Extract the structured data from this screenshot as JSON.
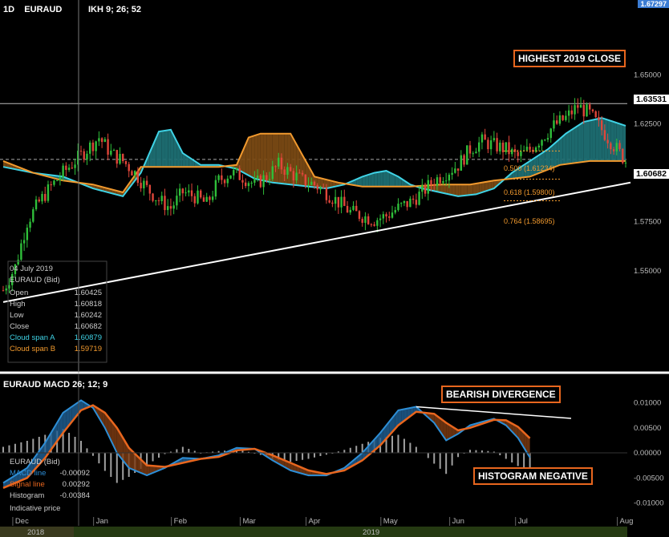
{
  "colors": {
    "bg": "#000000",
    "cloud_a": "#3fd3e6",
    "cloud_b": "#f29a2e",
    "cloud_fill_bull": "#1e6f73",
    "cloud_fill_bear": "#7a4a14",
    "up_candle": "#2fbf3a",
    "down_candle": "#e0463a",
    "macd_line": "#2d8ed6",
    "signal_line": "#e8661e",
    "callout": "#e8661e"
  },
  "header": {
    "timeframe": "1D",
    "symbol": "EURAUD",
    "indicator": "IKH 9; 26; 52"
  },
  "macd_header": {
    "label": "EURAUD  MACD 26; 12; 9"
  },
  "top_price_tag": "1.67297",
  "price_tags": {
    "current": "1.63531",
    "last": "1.60682"
  },
  "callouts": {
    "highest_close": "HIGHEST 2019 CLOSE",
    "bearish_divergence": "BEARISH DIVERGENCE",
    "histogram_negative": "HISTOGRAM NEGATIVE"
  },
  "fib_labels": [
    "0.500 (1.61234)",
    "0.618 (1.59800)",
    "0.764 (1.58695)"
  ],
  "info_box": {
    "date": "04 July 2019",
    "instrument": "EURAUD (Bid)",
    "rows": [
      {
        "label": "Open",
        "value": "1.60425"
      },
      {
        "label": "High",
        "value": "1.60818"
      },
      {
        "label": "Low",
        "value": "1.60242"
      },
      {
        "label": "Close",
        "value": "1.60682"
      },
      {
        "label": "Cloud span A",
        "value": "1.60879"
      },
      {
        "label": "Cloud span B",
        "value": "1.59719"
      }
    ]
  },
  "macd_info": {
    "instrument": "EURAUD (Bid)",
    "rows": [
      {
        "label": "MACD line",
        "value": "-0.00092"
      },
      {
        "label": "Signal line",
        "value": "0.00292"
      },
      {
        "label": "Histogram",
        "value": "-0.00384"
      }
    ],
    "footer": "Indicative price"
  },
  "chart_data": [
    {
      "type": "candlestick",
      "title": "EURAUD IKH 9; 26; 52",
      "ylim": [
        1.5,
        1.68
      ],
      "y_ticks": [
        "1.65000",
        "1.62500",
        "1.60000",
        "1.57500",
        "1.55000"
      ],
      "y_tick_values": [
        1.65,
        1.625,
        1.6,
        1.575,
        1.55
      ],
      "x_labels": [
        "Dec",
        "Jan",
        "Feb",
        "Mar",
        "Apr",
        "May",
        "Jun",
        "Jul",
        "Aug"
      ],
      "year_labels": [
        "2018",
        "2019"
      ],
      "horizontal_lines": [
        1.63531,
        1.60682
      ],
      "close_path": [
        [
          0,
          1.54
        ],
        [
          4,
          1.552
        ],
        [
          8,
          1.575
        ],
        [
          12,
          1.585
        ],
        [
          16,
          1.593
        ],
        [
          20,
          1.6
        ],
        [
          24,
          1.606
        ],
        [
          28,
          1.612
        ],
        [
          32,
          1.618
        ],
        [
          36,
          1.61
        ],
        [
          40,
          1.606
        ],
        [
          44,
          1.6
        ],
        [
          48,
          1.592
        ],
        [
          52,
          1.586
        ],
        [
          56,
          1.582
        ],
        [
          60,
          1.59
        ],
        [
          64,
          1.588
        ],
        [
          68,
          1.584
        ],
        [
          72,
          1.596
        ],
        [
          76,
          1.6
        ],
        [
          80,
          1.598
        ],
        [
          84,
          1.594
        ],
        [
          88,
          1.598
        ],
        [
          92,
          1.604
        ],
        [
          96,
          1.6
        ],
        [
          100,
          1.596
        ],
        [
          104,
          1.594
        ],
        [
          108,
          1.59
        ],
        [
          112,
          1.585
        ],
        [
          116,
          1.58
        ],
        [
          120,
          1.578
        ],
        [
          124,
          1.576
        ],
        [
          128,
          1.578
        ],
        [
          132,
          1.582
        ],
        [
          136,
          1.585
        ],
        [
          140,
          1.59
        ],
        [
          144,
          1.596
        ],
        [
          148,
          1.6
        ],
        [
          152,
          1.604
        ],
        [
          156,
          1.612
        ],
        [
          160,
          1.616
        ],
        [
          164,
          1.614
        ],
        [
          168,
          1.612
        ],
        [
          172,
          1.608
        ],
        [
          176,
          1.612
        ],
        [
          180,
          1.618
        ],
        [
          184,
          1.624
        ],
        [
          188,
          1.628
        ],
        [
          192,
          1.634
        ],
        [
          196,
          1.63
        ],
        [
          200,
          1.622
        ],
        [
          204,
          1.614
        ],
        [
          208,
          1.606
        ]
      ],
      "cloud_span_a": [
        [
          0,
          1.603
        ],
        [
          10,
          1.6
        ],
        [
          20,
          1.598
        ],
        [
          30,
          1.592
        ],
        [
          40,
          1.588
        ],
        [
          46,
          1.6
        ],
        [
          52,
          1.621
        ],
        [
          56,
          1.622
        ],
        [
          60,
          1.61
        ],
        [
          66,
          1.604
        ],
        [
          72,
          1.604
        ],
        [
          78,
          1.602
        ],
        [
          84,
          1.597
        ],
        [
          90,
          1.595
        ],
        [
          96,
          1.594
        ],
        [
          102,
          1.593
        ],
        [
          108,
          1.592
        ],
        [
          114,
          1.594
        ],
        [
          120,
          1.598
        ],
        [
          124,
          1.6
        ],
        [
          128,
          1.601
        ],
        [
          132,
          1.598
        ],
        [
          136,
          1.594
        ],
        [
          140,
          1.592
        ],
        [
          146,
          1.59
        ],
        [
          152,
          1.588
        ],
        [
          158,
          1.589
        ],
        [
          164,
          1.592
        ],
        [
          170,
          1.6
        ],
        [
          176,
          1.606
        ],
        [
          182,
          1.612
        ],
        [
          188,
          1.62
        ],
        [
          194,
          1.626
        ],
        [
          200,
          1.628
        ],
        [
          208,
          1.624
        ]
      ],
      "cloud_span_b": [
        [
          0,
          1.606
        ],
        [
          10,
          1.6
        ],
        [
          20,
          1.596
        ],
        [
          30,
          1.594
        ],
        [
          40,
          1.59
        ],
        [
          46,
          1.603
        ],
        [
          52,
          1.603
        ],
        [
          60,
          1.603
        ],
        [
          66,
          1.603
        ],
        [
          72,
          1.603
        ],
        [
          78,
          1.604
        ],
        [
          82,
          1.618
        ],
        [
          86,
          1.62
        ],
        [
          90,
          1.62
        ],
        [
          96,
          1.62
        ],
        [
          104,
          1.598
        ],
        [
          112,
          1.595
        ],
        [
          120,
          1.593
        ],
        [
          128,
          1.593
        ],
        [
          136,
          1.593
        ],
        [
          146,
          1.594
        ],
        [
          156,
          1.594
        ],
        [
          164,
          1.596
        ],
        [
          176,
          1.598
        ],
        [
          186,
          1.604
        ],
        [
          196,
          1.606
        ],
        [
          208,
          1.606
        ]
      ],
      "trendline": [
        [
          0,
          1.534
        ],
        [
          208,
          1.595
        ]
      ]
    },
    {
      "type": "line",
      "title": "EURAUD MACD 26; 12; 9",
      "ylim": [
        -0.012,
        0.012
      ],
      "y_ticks": [
        "0.01000",
        "0.00500",
        "0.00000",
        "-0.00500",
        "-0.01000"
      ],
      "y_tick_values": [
        0.01,
        0.005,
        0.0,
        -0.005,
        -0.01
      ],
      "series": [
        {
          "name": "MACD line",
          "points": [
            [
              0,
              -0.006
            ],
            [
              8,
              -0.003
            ],
            [
              14,
              0.002
            ],
            [
              20,
              0.008
            ],
            [
              26,
              0.0105
            ],
            [
              30,
              0.009
            ],
            [
              34,
              0.005
            ],
            [
              38,
              0.0
            ],
            [
              42,
              -0.003
            ],
            [
              48,
              -0.0045
            ],
            [
              54,
              -0.003
            ],
            [
              60,
              -0.001
            ],
            [
              66,
              -0.0012
            ],
            [
              72,
              -0.0005
            ],
            [
              78,
              0.001
            ],
            [
              84,
              0.0008
            ],
            [
              90,
              -0.0015
            ],
            [
              96,
              -0.0035
            ],
            [
              102,
              -0.0045
            ],
            [
              108,
              -0.0045
            ],
            [
              114,
              -0.003
            ],
            [
              120,
              0.0
            ],
            [
              126,
              0.004
            ],
            [
              132,
              0.0085
            ],
            [
              138,
              0.0092
            ],
            [
              144,
              0.006
            ],
            [
              148,
              0.0025
            ],
            [
              152,
              0.0038
            ],
            [
              156,
              0.0055
            ],
            [
              160,
              0.0062
            ],
            [
              164,
              0.0068
            ],
            [
              168,
              0.0055
            ],
            [
              172,
              0.003
            ],
            [
              176,
              -0.00092
            ]
          ]
        },
        {
          "name": "Signal line",
          "points": [
            [
              0,
              -0.007
            ],
            [
              8,
              -0.005
            ],
            [
              14,
              -0.001
            ],
            [
              20,
              0.004
            ],
            [
              26,
              0.0085
            ],
            [
              30,
              0.0095
            ],
            [
              34,
              0.008
            ],
            [
              38,
              0.005
            ],
            [
              42,
              0.001
            ],
            [
              48,
              -0.0025
            ],
            [
              54,
              -0.0028
            ],
            [
              60,
              -0.002
            ],
            [
              66,
              -0.0012
            ],
            [
              72,
              -0.0008
            ],
            [
              78,
              0.0005
            ],
            [
              84,
              0.0008
            ],
            [
              90,
              -0.0005
            ],
            [
              96,
              -0.002
            ],
            [
              102,
              -0.0035
            ],
            [
              108,
              -0.0042
            ],
            [
              114,
              -0.0035
            ],
            [
              120,
              -0.0015
            ],
            [
              126,
              0.0015
            ],
            [
              132,
              0.0055
            ],
            [
              138,
              0.0082
            ],
            [
              144,
              0.0078
            ],
            [
              148,
              0.006
            ],
            [
              152,
              0.0045
            ],
            [
              156,
              0.005
            ],
            [
              160,
              0.0058
            ],
            [
              164,
              0.0066
            ],
            [
              168,
              0.0065
            ],
            [
              172,
              0.0052
            ],
            [
              176,
              0.00292
            ]
          ]
        }
      ],
      "divergence_line": [
        [
          138,
          0.0092
        ],
        [
          184,
          0.0065
        ]
      ]
    }
  ]
}
